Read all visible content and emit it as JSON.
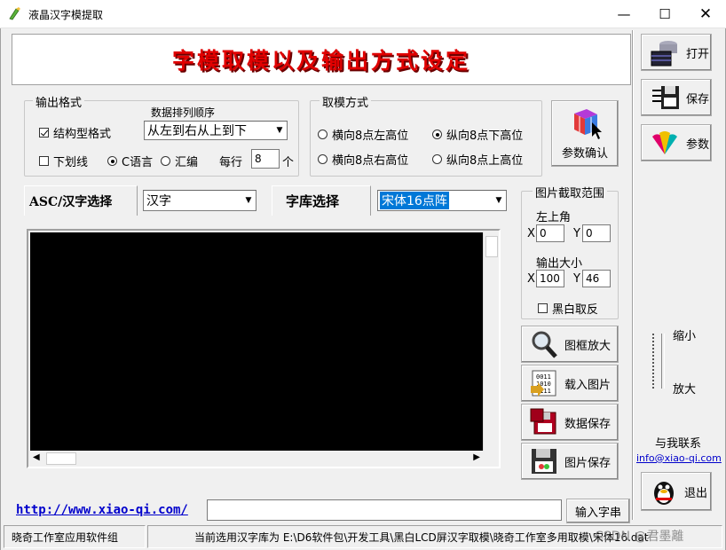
{
  "window": {
    "title": "液晶汉字模提取"
  },
  "banner": {
    "text": "字模取模以及输出方式设定"
  },
  "output_format": {
    "group_label": "输出格式",
    "sort_label": "数据排列顺序",
    "struct_label": "结构型格式",
    "sort_value": "从左到右从上到下",
    "underline_label": "下划线",
    "c_lang_label": "C语言",
    "asm_label": "汇编",
    "per_row_label": "每行",
    "per_row_value": "8",
    "per_row_unit": "个"
  },
  "mode": {
    "group_label": "取模方式",
    "opt1": "横向8点左高位",
    "opt2": "纵向8点下高位",
    "opt3": "横向8点右高位",
    "opt4": "纵向8点上高位"
  },
  "confirm_label": "参数确认",
  "asc_label": "ASC/汉字选择",
  "asc_value": "汉字",
  "font_label": "字库选择",
  "font_value": "宋体16点阵",
  "crop": {
    "group_label": "图片截取范围",
    "top_left_label": "左上角",
    "x_label": "X",
    "y_label": "Y",
    "x_value": "0",
    "y_value": "0",
    "size_label": "输出大小",
    "w_value": "100",
    "h_value": "46",
    "invert_label": "黑白取反"
  },
  "buttons": {
    "zoom": "图框放大",
    "load": "载入图片",
    "save_data": "数据保存",
    "save_image": "图片保存"
  },
  "right_panel": {
    "open": "打开",
    "save": "保存",
    "params": "参数",
    "shrink": "缩小",
    "enlarge": "放大",
    "contact_label": "与我联系",
    "email": "info@xiao-qi.com",
    "exit": "退出"
  },
  "footer": {
    "url": "http://www.xiao-qi.com/",
    "input_button": "输入字串",
    "status_left": "晓奇工作室应用软件组",
    "status_right": "当前选用汉字库为 E:\\D6软件包\\开发工具\\黑白LCD屏汉字取模\\晓奇工作室多用取模\\宋体16.dat"
  },
  "watermark": "CSDN @君墨離",
  "colors": {
    "banner_red": "#e00000",
    "link_blue": "#0000cc",
    "selection_blue": "#0078d7"
  }
}
